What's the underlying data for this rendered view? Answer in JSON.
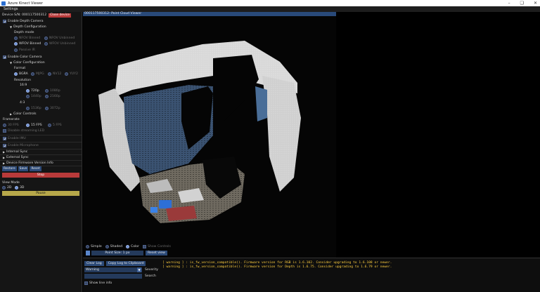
{
  "window": {
    "title": "Azure Kinect Viewer"
  },
  "menu": {
    "settings": "Settings"
  },
  "device": {
    "serial_label": "Device S/N: 000117500312",
    "close_label": "Close device"
  },
  "depth": {
    "enable_label": "Enable Depth Camera",
    "config_label": "Depth Configuration",
    "mode_label": "Depth mode",
    "options": [
      "NFOV Binned",
      "NFOV Unbinned",
      "WFOV Binned",
      "WFOV Unbinned",
      "Passive IR"
    ],
    "selected": "WFOV Binned"
  },
  "color": {
    "enable_label": "Enable Color Camera",
    "config_label": "Color Configuration",
    "format_label": "Format",
    "formats": [
      "BGRA",
      "MJPG",
      "NV12",
      "YUY2"
    ],
    "selected_format": "BGRA",
    "resolution_label": "Resolution",
    "ratio_169": "16:9",
    "res_169": [
      "720p",
      "1080p",
      "1440p",
      "2160p"
    ],
    "ratio_43": "4:3",
    "res_43": [
      "1536p",
      "3072p"
    ],
    "selected_res": "720p",
    "controls_label": "Color Controls"
  },
  "framerate": {
    "label": "Framerate",
    "options": [
      "30 FPS",
      "15 FPS",
      "5 FPS"
    ],
    "selected": "15 FPS"
  },
  "misc": {
    "disable_streaming_led": "Disable streaming LED",
    "enable_imu": "Enable IMU",
    "enable_microphone": "Enable Microphone",
    "internal_sync": "Internal Sync",
    "external_sync": "External Sync",
    "firmware_info": "Device Firmware Version Info"
  },
  "actions": {
    "restore": "Restore",
    "save": "Save",
    "reset": "Reset",
    "stop": "Stop",
    "pause": "Pause"
  },
  "view_mode": {
    "label": "View Mode",
    "options": [
      "2D",
      "3D"
    ],
    "selected": "3D"
  },
  "viewer": {
    "header": "000117500312: Point Cloud Viewer",
    "modes": [
      "Simple",
      "Shaded",
      "Color"
    ],
    "selected_mode": "Color",
    "show_controls": "Show Controls",
    "point_size": "Point Size: 1 px",
    "reset_view": "Reset view"
  },
  "log": {
    "clear": "Clear Log",
    "copy": "Copy Log to Clipboard",
    "severity_value": "Warning",
    "severity_label": "Severity",
    "search_label": "Search",
    "search_placeholder": "",
    "show_line_info": "Show line info",
    "messages": [
      "[ warning ] : is_fw_version_compatible(). Firmware version for RGB is 1.6.102. Consider upgrading to 1.6.108 or newer.",
      "[ warning ] : is_fw_version_compatible(). Firmware version for Depth is 1.6.75. Consider upgrading to 1.6.79 or newer."
    ]
  },
  "colors": {
    "accent": "#294a7a",
    "stop_red": "#b83a3a",
    "pause_yellow": "#b7a84a",
    "warning_text": "#ffcf3f"
  }
}
